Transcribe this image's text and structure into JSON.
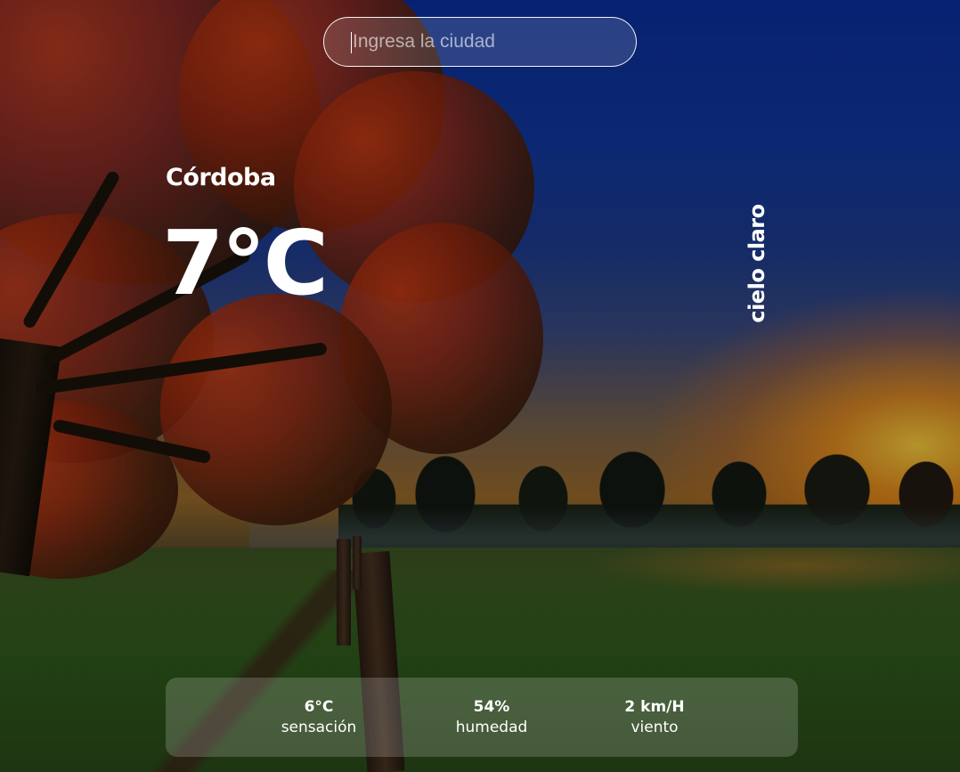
{
  "search": {
    "placeholder": "Ingresa la ciudad"
  },
  "weather": {
    "city": "Córdoba",
    "temperature": "7°C",
    "description": "cielo claro"
  },
  "details": [
    {
      "value": "6°C",
      "label": "sensación"
    },
    {
      "value": "54%",
      "label": "humedad"
    },
    {
      "value": "2 km/H",
      "label": "viento"
    }
  ]
}
